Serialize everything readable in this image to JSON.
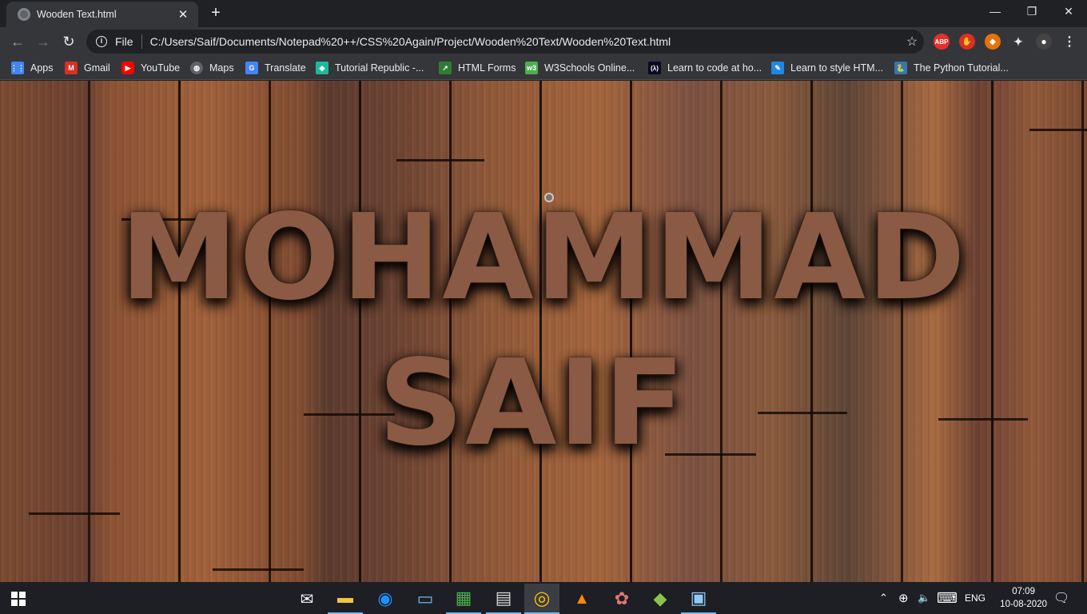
{
  "tab": {
    "title": "Wooden Text.html",
    "close": "✕"
  },
  "newtab": "+",
  "window": {
    "minimize": "—",
    "restore": "❐",
    "close": "✕"
  },
  "nav": {
    "back": "←",
    "forward": "→",
    "reload": "↻"
  },
  "omnibox": {
    "info": "i",
    "scheme": "File",
    "url": "C:/Users/Saif/Documents/Notepad%20++/CSS%20Again/Project/Wooden%20Text/Wooden%20Text.html",
    "star": "☆"
  },
  "extensions": [
    {
      "name": "adblock-plus-icon",
      "label": "ABP",
      "color": "#e4312b"
    },
    {
      "name": "hand-stop-icon",
      "label": "✋",
      "color": "#d93025"
    },
    {
      "name": "fox-icon",
      "label": "◆",
      "color": "#e8710a"
    },
    {
      "name": "puzzle-icon",
      "label": "✦",
      "color": "#5f6368"
    },
    {
      "name": "profile-avatar-icon",
      "label": "●",
      "color": "#444"
    }
  ],
  "menu": "⋮",
  "bookmarks": [
    {
      "label": "Apps",
      "icon": "apps-grid-icon",
      "color": "#4285f4",
      "glyph": "⋮⋮"
    },
    {
      "label": "Gmail",
      "icon": "gmail-icon",
      "color": "#d93025",
      "glyph": "M"
    },
    {
      "label": "YouTube",
      "icon": "youtube-icon",
      "color": "#ff0000",
      "glyph": "▶"
    },
    {
      "label": "Maps",
      "icon": "globe-icon",
      "color": "#5f6368",
      "glyph": "◍"
    },
    {
      "label": "Translate",
      "icon": "translate-icon",
      "color": "#4285f4",
      "glyph": "G"
    },
    {
      "label": "Tutorial Republic -...",
      "icon": "tutorial-republic-icon",
      "color": "#1abc9c",
      "glyph": "◆"
    },
    {
      "label": "HTML Forms",
      "icon": "html-forms-icon",
      "color": "#2e7d32",
      "glyph": "↗"
    },
    {
      "label": "W3Schools Online...",
      "icon": "w3schools-icon",
      "color": "#4caf50",
      "glyph": "w3"
    },
    {
      "label": "Learn to code at ho...",
      "icon": "freecodecamp-icon",
      "color": "#0a0a23",
      "glyph": "(λ)"
    },
    {
      "label": "Learn to style HTM...",
      "icon": "style-html-icon",
      "color": "#1e88e5",
      "glyph": "✎"
    },
    {
      "label": "The Python Tutorial...",
      "icon": "python-icon",
      "color": "#3776ab",
      "glyph": "🐍"
    }
  ],
  "page": {
    "line1": "MOHAMMAD",
    "line2": "SAIF"
  },
  "taskbar": {
    "apps": [
      {
        "name": "mail-icon",
        "glyph": "✉",
        "color": "#fff"
      },
      {
        "name": "file-explorer-icon",
        "glyph": "▬",
        "color": "#f4c542"
      },
      {
        "name": "edge-icon",
        "glyph": "◉",
        "color": "#1e90ff"
      },
      {
        "name": "computer-icon",
        "glyph": "▭",
        "color": "#6cb4ee"
      },
      {
        "name": "charts-app-icon",
        "glyph": "▦",
        "color": "#4caf50"
      },
      {
        "name": "calendar-app-icon",
        "glyph": "▤",
        "color": "#d8d8d8"
      },
      {
        "name": "chrome-icon",
        "glyph": "◎",
        "color": "#fbbc05"
      },
      {
        "name": "vlc-icon",
        "glyph": "▲",
        "color": "#ff8800"
      },
      {
        "name": "paint-icon",
        "glyph": "✿",
        "color": "#e57373"
      },
      {
        "name": "git-icon",
        "glyph": "◆",
        "color": "#8bc34a"
      },
      {
        "name": "python-idle-icon",
        "glyph": "▣",
        "color": "#90caf9"
      }
    ],
    "tray": {
      "chevron": "⌃",
      "network": "⊕",
      "volume": "🔈",
      "keyboard": "⌨",
      "lang": "ENG"
    },
    "time": "07:09",
    "date": "10-08-2020",
    "notifications": "🗨"
  }
}
